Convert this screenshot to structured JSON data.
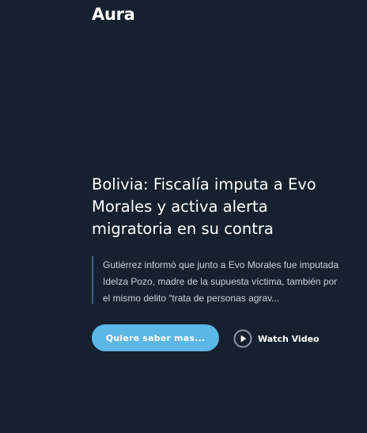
{
  "header": {
    "logo_text": "Aura"
  },
  "article": {
    "headline": "Bolivia: Fiscalía imputa a Evo Morales y activa alerta migratoria en su contra",
    "excerpt": "Gutiérrez informó que junto a Evo Morales fue imputada Idelza Pozo, madre de la supuesta víctima, también por el mismo delito “trata de personas agrav..."
  },
  "actions": {
    "read_more_label": "Quiere saber mas...",
    "watch_video_label": "Watch Video",
    "play_icon": "play-circle-icon"
  },
  "colors": {
    "background": "#15212f",
    "accent": "#5cb6e6",
    "quote_border": "#3a5f86"
  }
}
